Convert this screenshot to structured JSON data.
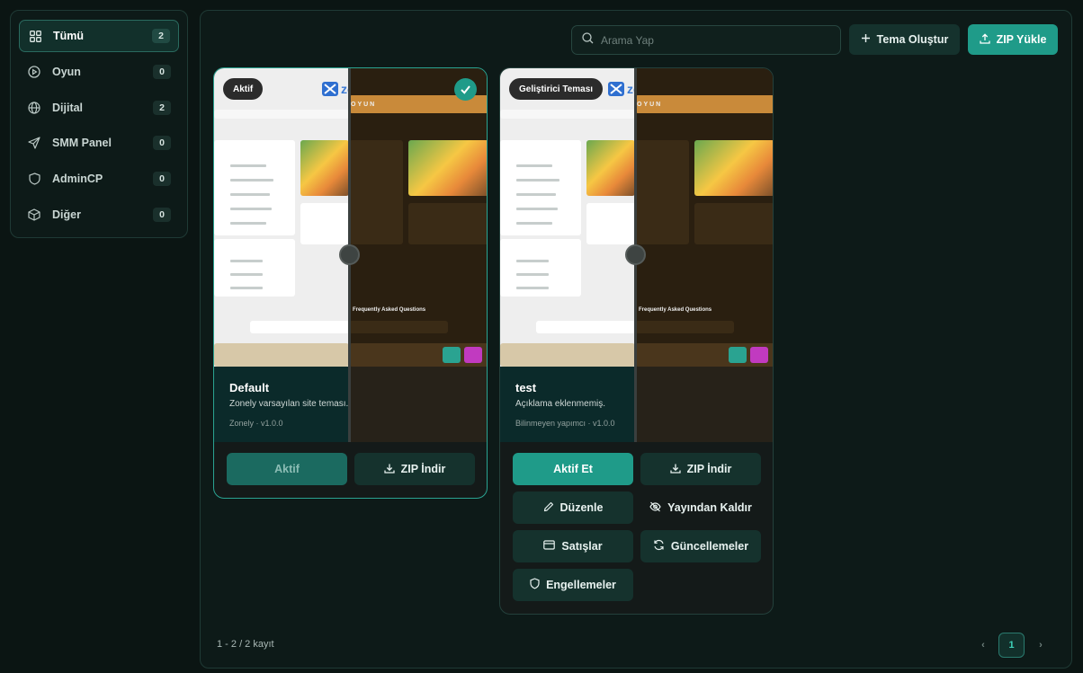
{
  "sidebar": {
    "items": [
      {
        "label": "Tümü",
        "count": "2",
        "icon": "grid-icon"
      },
      {
        "label": "Oyun",
        "count": "0",
        "icon": "play-circle-icon"
      },
      {
        "label": "Dijital",
        "count": "2",
        "icon": "globe-icon"
      },
      {
        "label": "SMM Panel",
        "count": "0",
        "icon": "send-icon"
      },
      {
        "label": "AdminCP",
        "count": "0",
        "icon": "shield-icon"
      },
      {
        "label": "Diğer",
        "count": "0",
        "icon": "box-icon"
      }
    ]
  },
  "toolbar": {
    "search_placeholder": "Arama Yap",
    "create_label": "Tema Oluştur",
    "upload_label": "ZIP Yükle"
  },
  "themes": [
    {
      "badge": "Aktif",
      "name": "Default",
      "description": "Zonely varsayılan site teması.",
      "meta": "Zonely · v1.0.0",
      "active": true,
      "actions": {
        "primary": "Aktif",
        "download": "ZIP İndir"
      }
    },
    {
      "badge": "Geliştirici Teması",
      "name": "test",
      "description": "Açıklama eklenmemiş.",
      "meta": "Bilinmeyen yapımcı · v1.0.0",
      "active": false,
      "actions": {
        "primary": "Aktif Et",
        "download": "ZIP İndir",
        "edit": "Düzenle",
        "unpublish": "Yayından Kaldır",
        "sales": "Satışlar",
        "updates": "Güncellemeler",
        "blocks": "Engellemeler"
      }
    }
  ],
  "preview": {
    "brand": "zonely",
    "page_heading": "OYUN",
    "faq_label": "Frequently Asked Questions"
  },
  "footer": {
    "record_info": "1 - 2 / 2 kayıt",
    "current_page": "1",
    "prev": "‹",
    "next": "›"
  },
  "colors": {
    "accent": "#1f9b89",
    "background": "#0b1513",
    "panel": "#0d1a18"
  }
}
